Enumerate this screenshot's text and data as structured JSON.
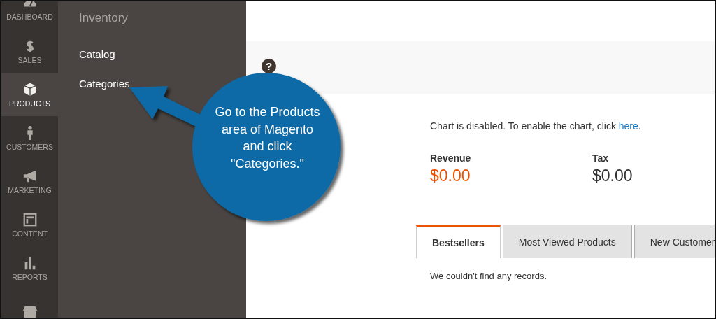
{
  "nav": [
    {
      "kind": "dashboard",
      "label": "DASHBOARD",
      "selected": false
    },
    {
      "kind": "sales",
      "label": "SALES",
      "selected": false
    },
    {
      "kind": "products",
      "label": "PRODUCTS",
      "selected": true
    },
    {
      "kind": "customers",
      "label": "CUSTOMERS",
      "selected": false
    },
    {
      "kind": "marketing",
      "label": "MARKETING",
      "selected": false
    },
    {
      "kind": "content",
      "label": "CONTENT",
      "selected": false
    },
    {
      "kind": "reports",
      "label": "REPORTS",
      "selected": false
    },
    {
      "kind": "store",
      "selected": false
    }
  ],
  "flyout": {
    "title": "Inventory",
    "items": [
      "Catalog",
      "Categories"
    ]
  },
  "header": {
    "help": "?"
  },
  "chart_notice": {
    "text": "Chart is disabled. To enable the chart, click ",
    "link": "here",
    "end": "."
  },
  "totals": [
    {
      "label": "Revenue",
      "value": "$0.00",
      "highlight": true
    },
    {
      "label": "Tax",
      "value": "$0.00",
      "highlight": false
    }
  ],
  "tabs": [
    {
      "label": "Bestsellers",
      "selected": true
    },
    {
      "label": "Most Viewed Products",
      "selected": false
    },
    {
      "label": "New Customer",
      "selected": false
    }
  ],
  "empty_message": "We couldn't find any records.",
  "callout": {
    "text": "Go to the Products area of Magento and click \"Categories.\""
  }
}
